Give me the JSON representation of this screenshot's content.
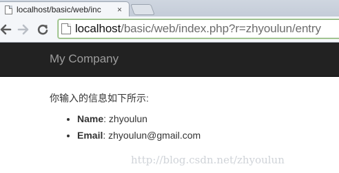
{
  "browser": {
    "tab_title": "localhost/basic/web/inc",
    "tab_close": "×",
    "url_host": "localhost",
    "url_path": "/basic/web/index.php?r=zhyoulun/entry"
  },
  "navbar": {
    "brand": "My Company",
    "background": "#222222",
    "brand_color": "#9d9d9d"
  },
  "content": {
    "intro": "你输入的信息如下所示:",
    "fields": [
      {
        "label": "Name",
        "separator": ": ",
        "value": "zhyoulun"
      },
      {
        "label": "Email",
        "separator": ": ",
        "value": "zhyoulun@gmail.com"
      }
    ]
  },
  "watermark": "http://blog.csdn.net/zhyoulun"
}
